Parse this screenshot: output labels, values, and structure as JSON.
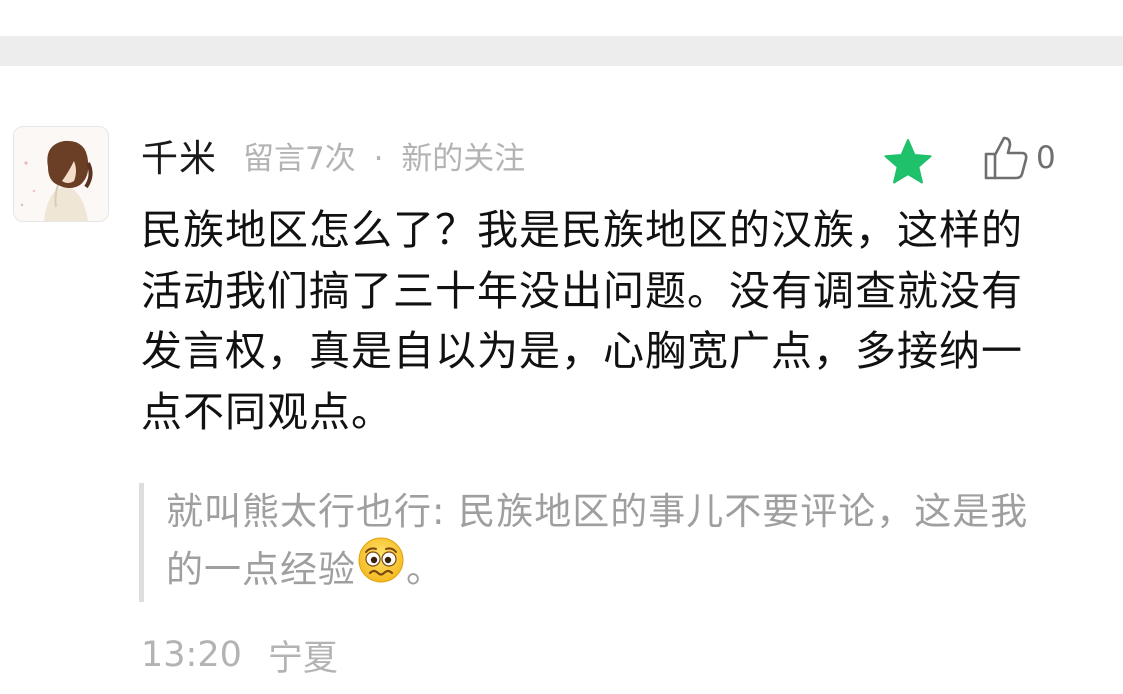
{
  "comment": {
    "nickname": "千米",
    "meta_count": "留言7次",
    "meta_separator": "·",
    "meta_tag": "新的关注",
    "like_count": "0",
    "body": "民族地区怎么了？我是民族地区的汉族，这样的活动我们搞了三十年没出问题。没有调查就没有发言权，真是自以为是，心胸宽广点，多接纳一点不同观点。",
    "quote_text": "就叫熊太行也行: 民族地区的事儿不要评论，这是我的一点经验",
    "quote_suffix": "。",
    "time": "13:20",
    "location": "宁夏"
  },
  "icons": {
    "star": "star-icon",
    "like": "thumbs-up-icon",
    "emoji": "worried-face-emoji"
  },
  "colors": {
    "star": "#1fc16b",
    "divider_band": "#ededed",
    "meta_text": "#b3b3b3",
    "quote_bar": "#dedede"
  }
}
